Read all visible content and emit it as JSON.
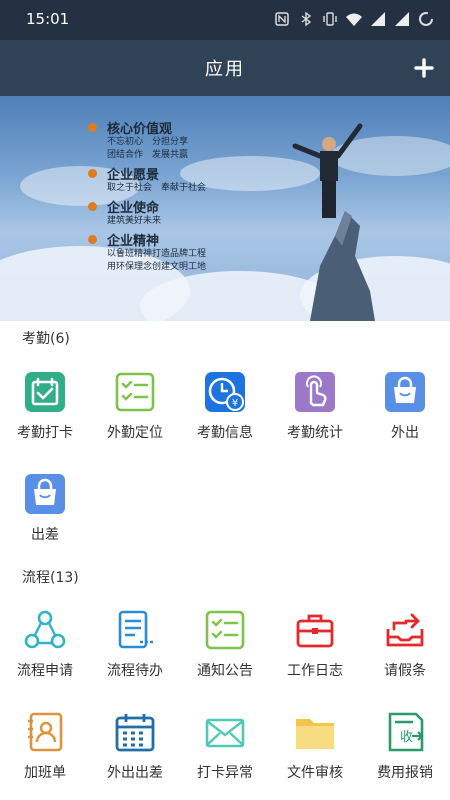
{
  "status_bar": {
    "time": "15:01"
  },
  "header": {
    "title": "应用"
  },
  "banner": {
    "headings": [
      {
        "title": "核心价值观",
        "lines": [
          "不忘初心　分担分享",
          "团结合作　发展共赢"
        ]
      },
      {
        "title": "企业愿景",
        "lines": [
          "取之于社会　奉献于社会"
        ]
      },
      {
        "title": "企业使命",
        "lines": [
          "建筑美好未来"
        ]
      },
      {
        "title": "企业精神",
        "lines": [
          "以鲁班精神打造品牌工程",
          "用环保理念创建文明工地"
        ]
      }
    ]
  },
  "attendance": {
    "title": "考勤(6)",
    "items": [
      {
        "label": "考勤打卡",
        "icon": "calendar-check-icon"
      },
      {
        "label": "外勤定位",
        "icon": "checklist-icon"
      },
      {
        "label": "考勤信息",
        "icon": "clock-yen-icon"
      },
      {
        "label": "考勤统计",
        "icon": "hand-tap-icon"
      },
      {
        "label": "外出",
        "icon": "bag-icon"
      },
      {
        "label": "出差",
        "icon": "bag-icon"
      }
    ]
  },
  "workflow": {
    "title": "流程(13)",
    "items": [
      {
        "label": "流程申请",
        "icon": "flow-nodes-icon"
      },
      {
        "label": "流程待办",
        "icon": "document-list-icon"
      },
      {
        "label": "通知公告",
        "icon": "checklist-icon"
      },
      {
        "label": "工作日志",
        "icon": "toolbox-icon"
      },
      {
        "label": "请假条",
        "icon": "tray-upload-icon"
      },
      {
        "label": "加班单",
        "icon": "contact-card-icon"
      },
      {
        "label": "外出出差",
        "icon": "calendar-grid-icon"
      },
      {
        "label": "打卡异常",
        "icon": "envelope-icon"
      },
      {
        "label": "文件审核",
        "icon": "folder-icon"
      },
      {
        "label": "费用报销",
        "icon": "receipt-icon"
      }
    ]
  }
}
